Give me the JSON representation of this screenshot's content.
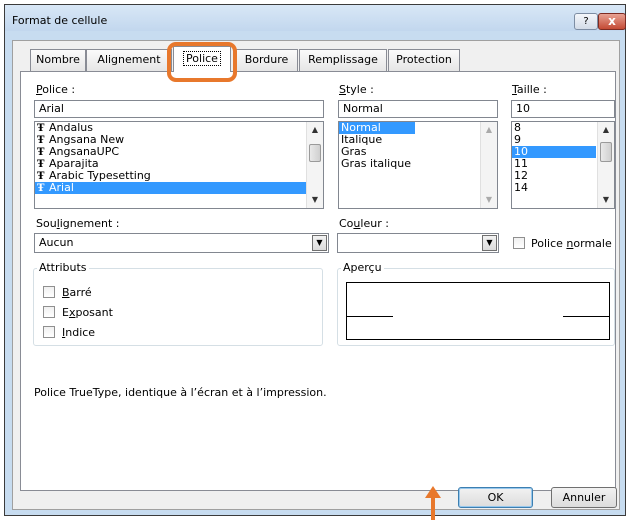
{
  "dialog": {
    "title": "Format de cellule",
    "help_label": "?",
    "close_label": "x"
  },
  "tabs": [
    {
      "label": "Nombre",
      "active": false
    },
    {
      "label": "Alignement",
      "active": false
    },
    {
      "label": "Police",
      "active": true
    },
    {
      "label": "Bordure",
      "active": false
    },
    {
      "label": "Remplissage",
      "active": false
    },
    {
      "label": "Protection",
      "active": false
    }
  ],
  "font": {
    "label_accel": "P",
    "label_rest": "olice :",
    "value": "Arial",
    "icon_glyph": "Ŧ",
    "items": [
      "Andalus",
      "Angsana New",
      "AngsanaUPC",
      "Aparajita",
      "Arabic Typesetting",
      "Arial"
    ],
    "selected": "Arial"
  },
  "style": {
    "label_accel": "S",
    "label_rest": "tyle :",
    "value": "Normal",
    "items": [
      "Normal",
      "Italique",
      "Gras",
      "Gras italique"
    ],
    "selected": "Normal"
  },
  "size": {
    "label_accel": "T",
    "label_rest": "aille :",
    "value": "10",
    "items": [
      "8",
      "9",
      "10",
      "11",
      "12",
      "14"
    ],
    "selected": "10"
  },
  "underline": {
    "label_pre": "Sou",
    "label_accel": "l",
    "label_rest": "ignement :",
    "value": "Aucun"
  },
  "color": {
    "label_pre": "Co",
    "label_accel": "u",
    "label_rest": "leur :",
    "value": ""
  },
  "normal_font": {
    "label_pre": "Police ",
    "label_accel": "n",
    "label_rest": "ormale",
    "checked": false
  },
  "attributes": {
    "title": "Attributs",
    "strikethrough": {
      "accel": "B",
      "rest": "arré",
      "checked": false
    },
    "superscript": {
      "pre": "E",
      "accel": "x",
      "rest": "posant",
      "checked": false
    },
    "subscript": {
      "accel": "I",
      "rest": "ndice",
      "checked": false
    }
  },
  "preview": {
    "title": "Aperçu"
  },
  "description": "Police TrueType, identique à l’écran et à l’impression.",
  "buttons": {
    "ok": "OK",
    "cancel": "Annuler"
  },
  "colors": {
    "highlight": "#e8782c",
    "selection": "#3399ff"
  },
  "icons": {
    "scroll_up": "▲",
    "scroll_down": "▼",
    "dropdown": "▼"
  }
}
